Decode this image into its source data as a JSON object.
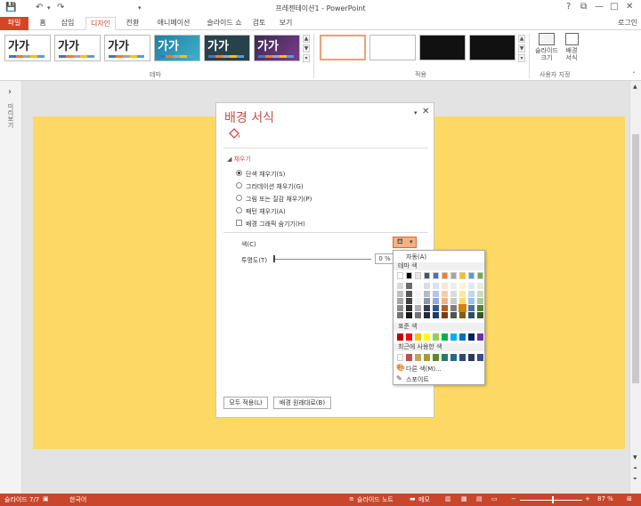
{
  "app": {
    "title": "프레젠테이션1 - PowerPoint",
    "window_buttons": [
      "?",
      "⧉",
      "—",
      "□",
      "✕"
    ]
  },
  "quick_access": [
    "💾",
    "↶",
    "▾",
    "↷",
    "▾"
  ],
  "tabs": [
    {
      "label": "파일"
    },
    {
      "label": "홈"
    },
    {
      "label": "삽입"
    },
    {
      "label": "디자인"
    },
    {
      "label": "전환"
    },
    {
      "label": "애니메이션"
    },
    {
      "label": "슬라이드 쇼"
    },
    {
      "label": "검토"
    },
    {
      "label": "보기"
    }
  ],
  "login": "로그인",
  "ribbon": {
    "themes": [
      {
        "text": "가가",
        "bg": "#ffffff"
      },
      {
        "text": "가가",
        "bg": "#ffffff"
      },
      {
        "text": "가가",
        "bg": "#ffffff"
      },
      {
        "text": "가가",
        "bg": "#1f7fa3"
      },
      {
        "text": "가가",
        "bg": "#27424b"
      },
      {
        "text": "가가",
        "bg": "#3b2a4f"
      }
    ],
    "theme_group": "테마",
    "variants": [
      {
        "bg": "#ffffff",
        "accent": "#d24726"
      },
      {
        "bg": "#ffffff",
        "accent": "#aaaaaa"
      },
      {
        "bg": "#111111",
        "accent": "#555555"
      },
      {
        "bg": "#111111",
        "accent": "#555555"
      }
    ],
    "variant_group": "적용",
    "slide_size": "슬라이드\n크기",
    "format_bg": "배경\n서식",
    "custom_group": "사용자 지정"
  },
  "left_pane": {
    "arrow": "›",
    "label": "미리보기"
  },
  "format_pane": {
    "title": "배경 서식",
    "section": "채우기",
    "options": [
      "단색 채우기(S)",
      "그라데이션 채우기(G)",
      "그림 또는 질감 채우기(P)",
      "패턴 채우기(A)"
    ],
    "selected_index": 0,
    "hide_bg": "배경 그래픽 숨기기(H)",
    "color_label": "색(C)",
    "transparency_label": "투명도(T)",
    "transparency_value": "0 %",
    "apply_all": "모두 적용(L)",
    "reset": "배경 원래대로(B)"
  },
  "palette": {
    "auto": "자동(A)",
    "theme_colors_label": "테마 색",
    "theme_base": [
      "#ffffff",
      "#000000",
      "#e7e6e6",
      "#44546a",
      "#4472c4",
      "#ed7d31",
      "#a5a5a5",
      "#ffc000",
      "#5b9bd5",
      "#70ad47"
    ],
    "standard_label": "표준 색",
    "standard": [
      "#c00000",
      "#ff0000",
      "#ffc000",
      "#ffff00",
      "#92d050",
      "#00b050",
      "#00b0f0",
      "#0070c0",
      "#002060",
      "#7030a0"
    ],
    "recent_label": "최근에 사용한 색",
    "recent": [
      "#ffffff",
      "#c0504d",
      "#c4a35a",
      "#a79a3a",
      "#5a8a2a",
      "#2a7a6a",
      "#1f6d8a",
      "#2a4a7a",
      "#2c3a5a",
      "#3a4a8a"
    ],
    "more": "다른 색(M)...",
    "eyedropper": "스포이트",
    "selected_color": "#ffc000"
  },
  "status": {
    "slide": "슬라이드 7/7",
    "language": "한국어",
    "notes": "슬라이드 노트",
    "comments": "메모",
    "zoom": "87 %"
  }
}
